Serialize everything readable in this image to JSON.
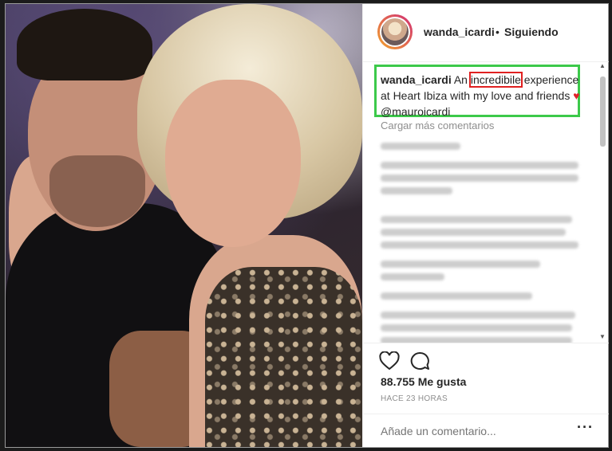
{
  "header": {
    "username": "wanda_icardi",
    "separator": "•",
    "follow_status": "Siguiendo"
  },
  "caption": {
    "username": "wanda_icardi",
    "text_before": "An ",
    "highlight_word": "incredibile",
    "text_after": " experience at Heart Ibiza with my love and friends ",
    "heart": "♥",
    "mention": "@mauroicardi"
  },
  "comments": {
    "load_more": "Cargar más comentarios"
  },
  "stats": {
    "likes": "88.755 Me gusta",
    "time": "HACE 23 HORAS"
  },
  "footer": {
    "add_comment_placeholder": "Añade un comentario...",
    "more_label": "···"
  },
  "colors": {
    "caption_box": "#3cc94a",
    "highlight_box": "#e02020",
    "heart": "#e0232a",
    "secondary_text": "#8e8e8e"
  },
  "icons": [
    "heart-icon",
    "comment-icon",
    "more-icon"
  ]
}
